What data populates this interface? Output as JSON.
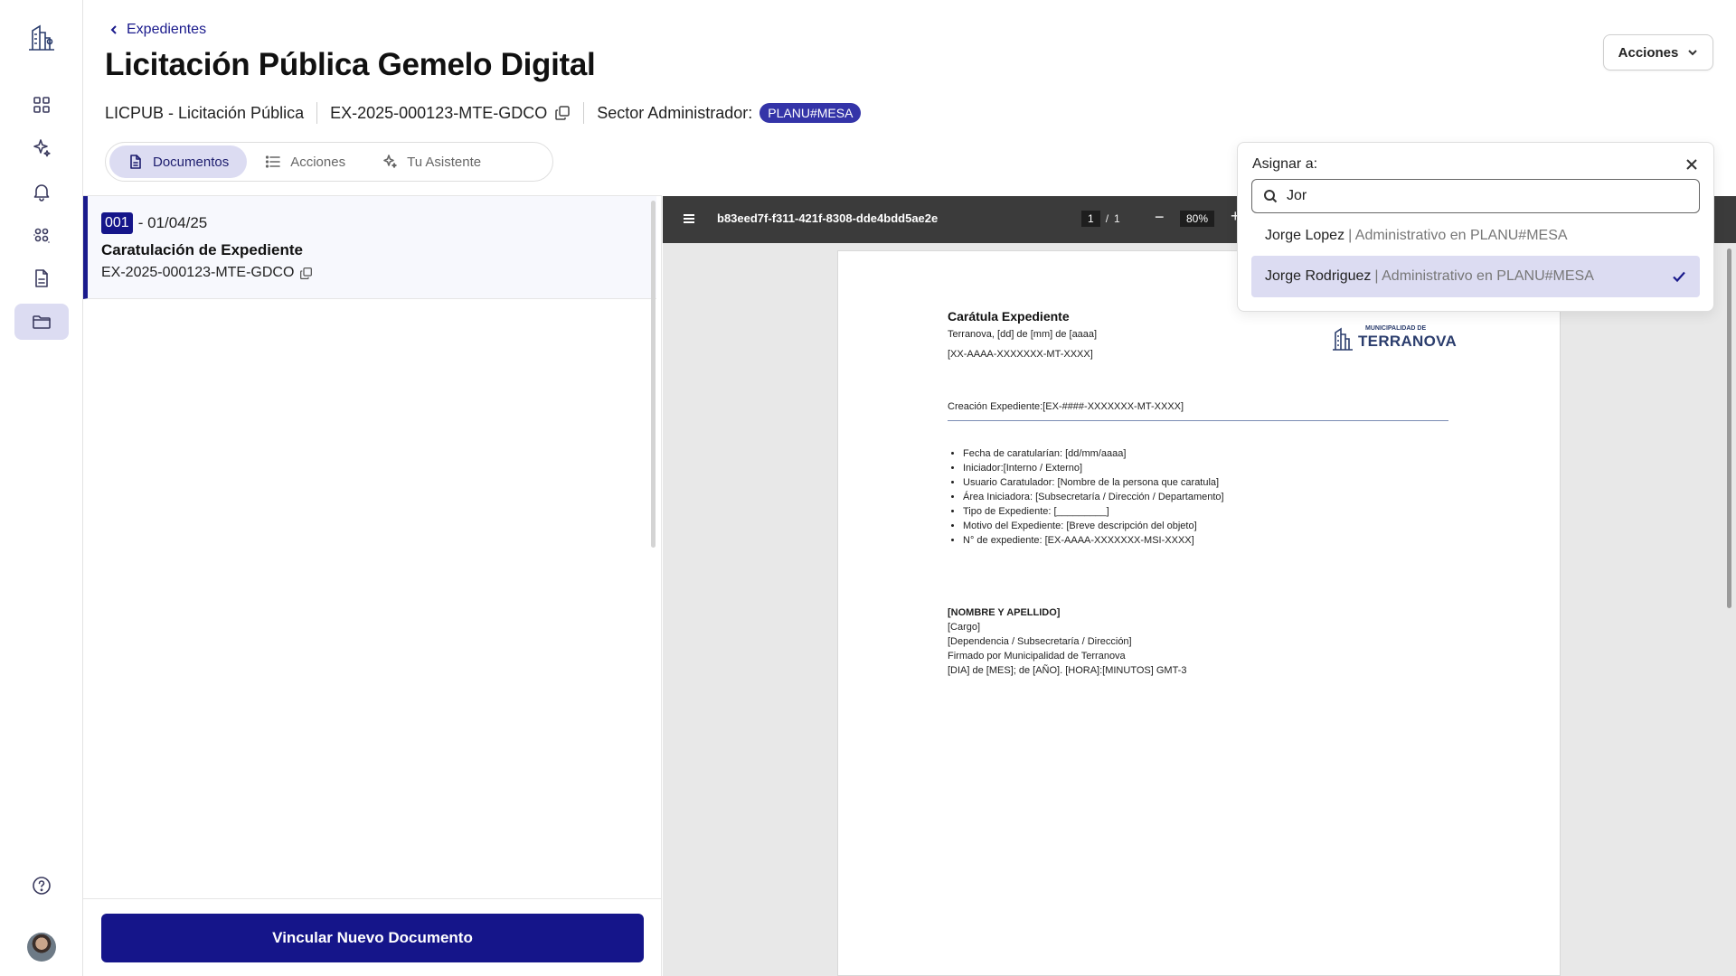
{
  "header": {
    "back_label": "Expedientes",
    "title": "Licitación Pública Gemelo Digital",
    "type": "LICPUB - Licitación Pública",
    "code": "EX-2025-000123-MTE-GDCO",
    "sector_label": "Sector Administrador:",
    "sector_badge": "PLANU#MESA",
    "actions_label": "Acciones"
  },
  "tabs": [
    {
      "label": "Documentos",
      "icon": "document-icon",
      "active": true
    },
    {
      "label": "Acciones",
      "icon": "list-icon",
      "active": false
    },
    {
      "label": "Tu Asistente",
      "icon": "sparkle-icon",
      "active": false
    }
  ],
  "documents": [
    {
      "number": "001",
      "date": "- 01/04/25",
      "title": "Caratulación de Expediente",
      "code": "EX-2025-000123-MTE-GDCO"
    }
  ],
  "footer": {
    "link_button": "Vincular Nuevo Documento"
  },
  "viewer": {
    "filename": "b83eed7f-f311-421f-8308-dde4bdd5ae2e",
    "page_current": "1",
    "page_sep": "/",
    "page_total": "1",
    "zoom": "80%",
    "zoom_out": "−",
    "zoom_in": "+"
  },
  "paper": {
    "title": "Carátula Expediente",
    "date_line": "Terranova, [dd] de [mm]  de [aaaa]",
    "code_line": "[XX-AAAA-XXXXXXX-MT-XXXX]",
    "creation_line": "Creación Expediente:[EX-####-XXXXXXX-MT-XXXX]",
    "logo_small": "MUNICIPALIDAD DE",
    "logo_big": "TERRANOVA",
    "bullets": [
      "Fecha de caratularían: [dd/mm/aaaa]",
      "Iniciador:[Interno / Externo]",
      "Usuario Caratulador: [Nombre de la persona que caratula]",
      "Área Iniciadora: [Subsecretaría / Dirección / Departamento]",
      "Tipo de Expediente: [_________]",
      "Motivo del Expediente: [Breve descripción del objeto]",
      "N° de expediente: [EX-AAAA-XXXXXXX-MSI-XXXX]"
    ],
    "signature": [
      "[NOMBRE Y APELLIDO]",
      "[Cargo]",
      "[Dependencia / Subsecretaría / Dirección]",
      "Firmado por Municipalidad de Terranova",
      "[DIA] de [MES]; de [AÑO]. [HORA]:[MINUTOS] GMT-3"
    ]
  },
  "assign": {
    "label": "Asignar a:",
    "search_value": "Jor",
    "options": [
      {
        "name": "Jorge Lopez",
        "role": "| Administrativo en PLANU#MESA",
        "selected": false
      },
      {
        "name": "Jorge Rodriguez",
        "role": "| Administrativo en PLANU#MESA",
        "selected": true
      }
    ]
  },
  "sidebar": {
    "items": [
      {
        "icon": "grid-icon",
        "active": false
      },
      {
        "icon": "sparkle-icon",
        "active": false
      },
      {
        "icon": "bell-icon",
        "active": false
      },
      {
        "icon": "users-icon",
        "active": false
      },
      {
        "icon": "file-icon",
        "active": false
      },
      {
        "icon": "folder-icon",
        "active": true
      }
    ],
    "help_icon": "help-icon"
  },
  "colors": {
    "primary": "#15158a",
    "accent_light": "#dcdcf2",
    "badge": "#3434a8",
    "viewer_bar": "#3b3b3b"
  }
}
